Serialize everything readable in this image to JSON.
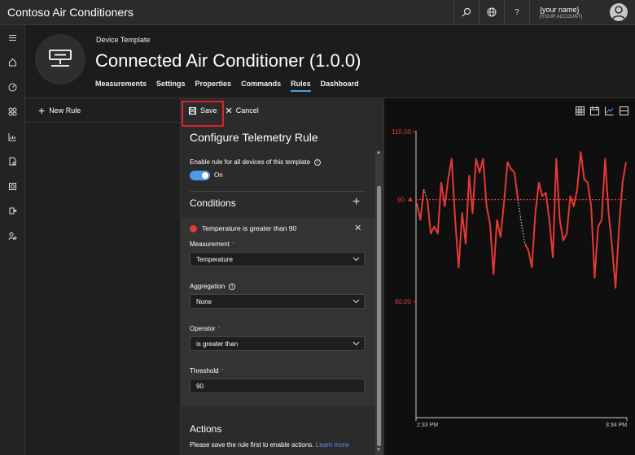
{
  "app": {
    "title": "Contoso Air Conditioners"
  },
  "account": {
    "name": "{your name}",
    "account": "{YOUR ACCOUNT}"
  },
  "topbar": {
    "help_label": "?"
  },
  "header": {
    "subtitle": "Device Template",
    "title": "Connected Air Conditioner",
    "version": "(1.0.0)",
    "tabs": [
      {
        "label": "Measurements"
      },
      {
        "label": "Settings"
      },
      {
        "label": "Properties"
      },
      {
        "label": "Commands"
      },
      {
        "label": "Rules"
      },
      {
        "label": "Dashboard"
      }
    ],
    "active_tab": "Rules"
  },
  "left_pane": {
    "new_rule_label": "New Rule"
  },
  "rule_panel": {
    "save_label": "Save",
    "cancel_label": "Cancel",
    "title": "Configure Telemetry Rule",
    "enable_label": "Enable rule for all devices of this template",
    "toggle_state": "On",
    "conditions_heading": "Conditions",
    "condition": {
      "summary": "Temperature is greater than 90",
      "measurement_label": "Measurement",
      "measurement_value": "Temperature",
      "aggregation_label": "Aggregation",
      "aggregation_value": "None",
      "operator_label": "Operator",
      "operator_value": "is greater than",
      "threshold_label": "Threshold",
      "threshold_value": "90"
    },
    "actions_heading": "Actions",
    "actions_text": "Please save the rule first to enable actions.",
    "actions_link": "Learn more"
  },
  "colors": {
    "accent": "#4f9bea",
    "series": "#e53935",
    "highlight": "#d9232e"
  },
  "chart_data": {
    "type": "line",
    "y_ticks": [
      "110.00",
      "60.00"
    ],
    "threshold_label": "90",
    "threshold": 90,
    "x_ticks": [
      "2:33 PM",
      "3:34 PM"
    ],
    "ylim": [
      54,
      110
    ],
    "series": [
      {
        "values": [
          89,
          84,
          93,
          90,
          80,
          82,
          80,
          95,
          88,
          96,
          102,
          84,
          70,
          86,
          77,
          97,
          86,
          102,
          98,
          102,
          88,
          83,
          68,
          84,
          79,
          89,
          101,
          99,
          98,
          90,
          83,
          77,
          75,
          70,
          86,
          95,
          91,
          92,
          84,
          73,
          102,
          84,
          78,
          80,
          91,
          88,
          93,
          104,
          96,
          95,
          88,
          67,
          82,
          84,
          102,
          86,
          76,
          64,
          82,
          95,
          101
        ]
      }
    ],
    "gaps": [
      [
        2,
        3
      ],
      [
        29,
        31
      ]
    ]
  }
}
